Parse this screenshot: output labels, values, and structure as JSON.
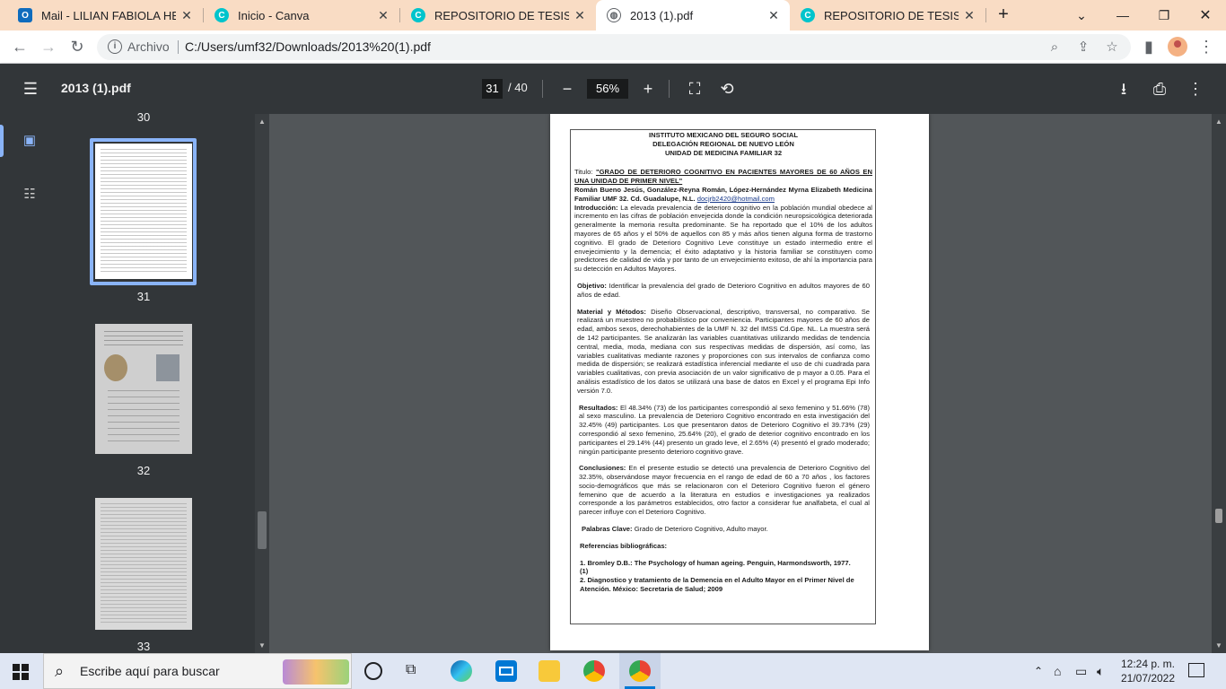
{
  "browser": {
    "tabs": [
      {
        "title": "Mail - LILIAN FABIOLA HERN",
        "favicon": "outlook-icon"
      },
      {
        "title": "Inicio - Canva",
        "favicon": "canva-icon"
      },
      {
        "title": "REPOSITORIO DE TESIS UMF",
        "favicon": "canva-icon"
      },
      {
        "title": "2013 (1).pdf",
        "favicon": "globe-icon"
      },
      {
        "title": "REPOSITORIO DE TESIS UMF",
        "favicon": "canva-icon"
      }
    ],
    "new_tab": "+",
    "scheme_label": "Archivo",
    "url": "C:/Users/umf32/Downloads/2013%20(1).pdf"
  },
  "pdf_toolbar": {
    "title": "2013 (1).pdf",
    "current_page": "31",
    "total_pages": "/ 40",
    "zoom": "56%"
  },
  "sidebar": {
    "label_top": "30",
    "thumbnails": [
      {
        "number": "31",
        "selected": true
      },
      {
        "number": "32",
        "selected": false
      },
      {
        "number": "33",
        "selected": false
      }
    ]
  },
  "document": {
    "header1": "INSTITUTO MEXICANO DEL SEGURO SOCIAL",
    "header2": "DELEGACIÓN REGIONAL DE NUEVO LEÓN",
    "header3": "UNIDAD DE MEDICINA FAMILIAR 32",
    "title_label": "Titulo:",
    "title": "\"GRADO DE  DETERIORO COGNITIVO EN PACIENTES MAYORES DE  60 AÑOS EN UNA UNIDAD DE PRIMER NIVEL\"",
    "authors": "Román Bueno Jesús,  González-Reyna Román, López-Hernández Myrna Elizabeth Medicina Familiar UMF 32. Cd. Guadalupe, N.L.",
    "email": "docjrb2420@hotmail.com",
    "intro_label": "Introducción:",
    "intro": "La elevada prevalencia de deterioro cognitivo en la población mundial obedece al incremento en las cifras de población envejecida donde la condición neuropsicológica deteriorada generalmente la memoria resulta predominante. Se ha reportado que el 10% de los adultos mayores de 65 años y el 50% de aquellos con 85 y más años tienen alguna forma de trastorno cognitivo. El grado de Deterioro Cognitivo Leve constituye un estado intermedio entre el envejecimiento y la demencia; el éxito adaptativo y la historia familiar se constituyen como predictores de calidad de vida y por tanto de un envejecimiento exitoso, de ahí la importancia para su detección en Adultos Mayores.",
    "obj_label": "Objetivo:",
    "obj": "Identificar la prevalencia del grado de Deterioro Cognitivo    en  adultos mayores de  60  años de  edad.",
    "methods_label": "Material y Métodos:",
    "methods": "Diseño Observacional, descriptivo, transversal, no comparativo. Se realizará un muestreo no probabilístico por conveniencia. Participantes mayores de 60 años de edad, ambos sexos, derechohabientes de la UMF N. 32 del IMSS Cd.Gpe. NL. La muestra será de  142 participantes. Se analizarán las variables cuantitativas utilizando medidas de tendencia central, media, moda, mediana con sus respectivas medidas de dispersión, así como, las variables cualitativas mediante razones y proporciones con sus intervalos de confianza como medida de dispersión; se realizará estadística inferencial mediante el uso de chi cuadrada para variables cualitativas, con previa asociación de un valor significativo de p mayor a 0.05. Para el análisis estadístico de los datos se utilizará una base de datos en Excel y  el programa Epi Info versión 7.0.",
    "results_label": "Resultados:",
    "results": "El  48.34% (73) de los participantes  correspondió al sexo femenino y 51.66% (78) al sexo masculino. La  prevalencia de Deterioro Cognitivo encontrado en esta investigación del 32.45% (49) participantes.  Los que presentaron datos de  Deterioro Cognitivo el 39.73% (29) correspondió al sexo femenino, 25.64% (20), el grado de deterior cognitivo encontrado en los participantes el 29.14% (44) presento un grado leve,  el 2.65% (4) presentó el grado moderado; ningún participante presento  deterioro cognitivo grave.",
    "concl_label": "Conclusiones:",
    "concl": "En el presente estudio se detectó  una prevalencia de Deterioro Cognitivo del 32.35%,  observándose  mayor frecuencia en el rango de edad de 60 a 70 años , los factores  socio-demográficos que más se relacionaron con el Deterioro  Cognitivo fueron el género femenino que de acuerdo a la literatura  en estudios e investigaciones ya realizados corresponde a  los parámetros establecidos, otro factor a considerar  fue analfabeta, el cual  al parecer  influye con  el Deterioro Cognitivo.",
    "keywords_label": "Palabras Clave:",
    "keywords": "Grado de Deterioro Cognitivo, Adulto mayor.",
    "refs_label": "Referencias  bibliográficas:",
    "ref1": "1. Bromley D.B.: The Psychology of human ageing. Penguin, Harmondsworth, 1977.(1)",
    "ref2": "2. Diagnostico y  tratamiento de la  Demencia  en  el  Adulto Mayor en  el  Primer Nivel  de Atención. México: Secretaria  de  Salud; 2009"
  },
  "taskbar": {
    "search_placeholder": "Escribe aquí para buscar",
    "time": "12:24 p. m.",
    "date": "21/07/2022"
  },
  "colors": {
    "tabstrip": "#f9dcc4",
    "pdf_toolbar": "#323639",
    "viewer_bg": "#525659",
    "accent": "#8ab4f8"
  }
}
